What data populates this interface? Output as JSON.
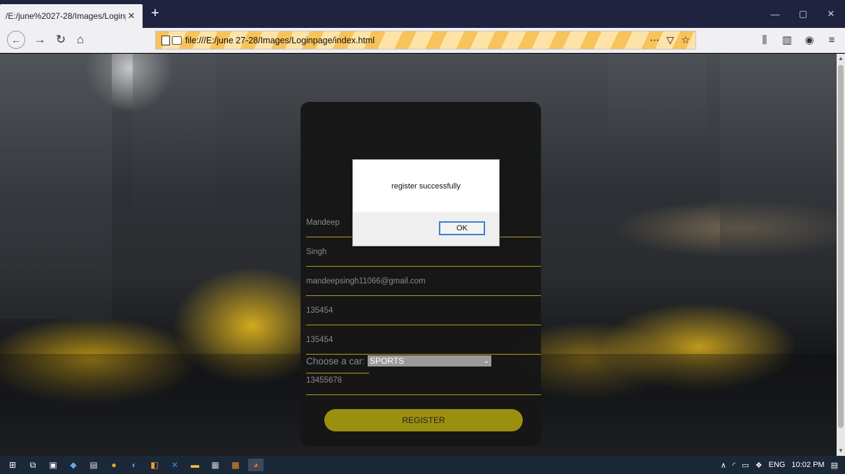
{
  "browser": {
    "tab_title": "/E:/june%2027-28/Images/Loginpa",
    "tab_close": "✕",
    "new_tab": "+",
    "url": "file:///E:/june 27-28/Images/Loginpage/index.html",
    "url_actions": [
      "⋯",
      "▽",
      "☆"
    ],
    "window_controls": [
      "—",
      "▢",
      "✕"
    ],
    "toolbar_icons": [
      "library-icon",
      "sidebar-icon",
      "account-icon",
      "menu-icon"
    ]
  },
  "form": {
    "first_name": "Mandeep",
    "last_name": "Singh",
    "email": "mandeepsingh11066@gmail.com",
    "password": "135454",
    "confirm_password": "135454",
    "car_label": "Choose a car:",
    "car_selected": "SPORTS",
    "phone": "13455678",
    "register_label": "REGISTER"
  },
  "dialog": {
    "message": "register successfully",
    "ok_label": "OK"
  },
  "taskbar": {
    "language": "ENG",
    "time": "10:02 PM"
  },
  "colors": {
    "accent_gold": "#b69a1e",
    "register_button": "#9b8f0f",
    "tab_strip": "#202340"
  }
}
